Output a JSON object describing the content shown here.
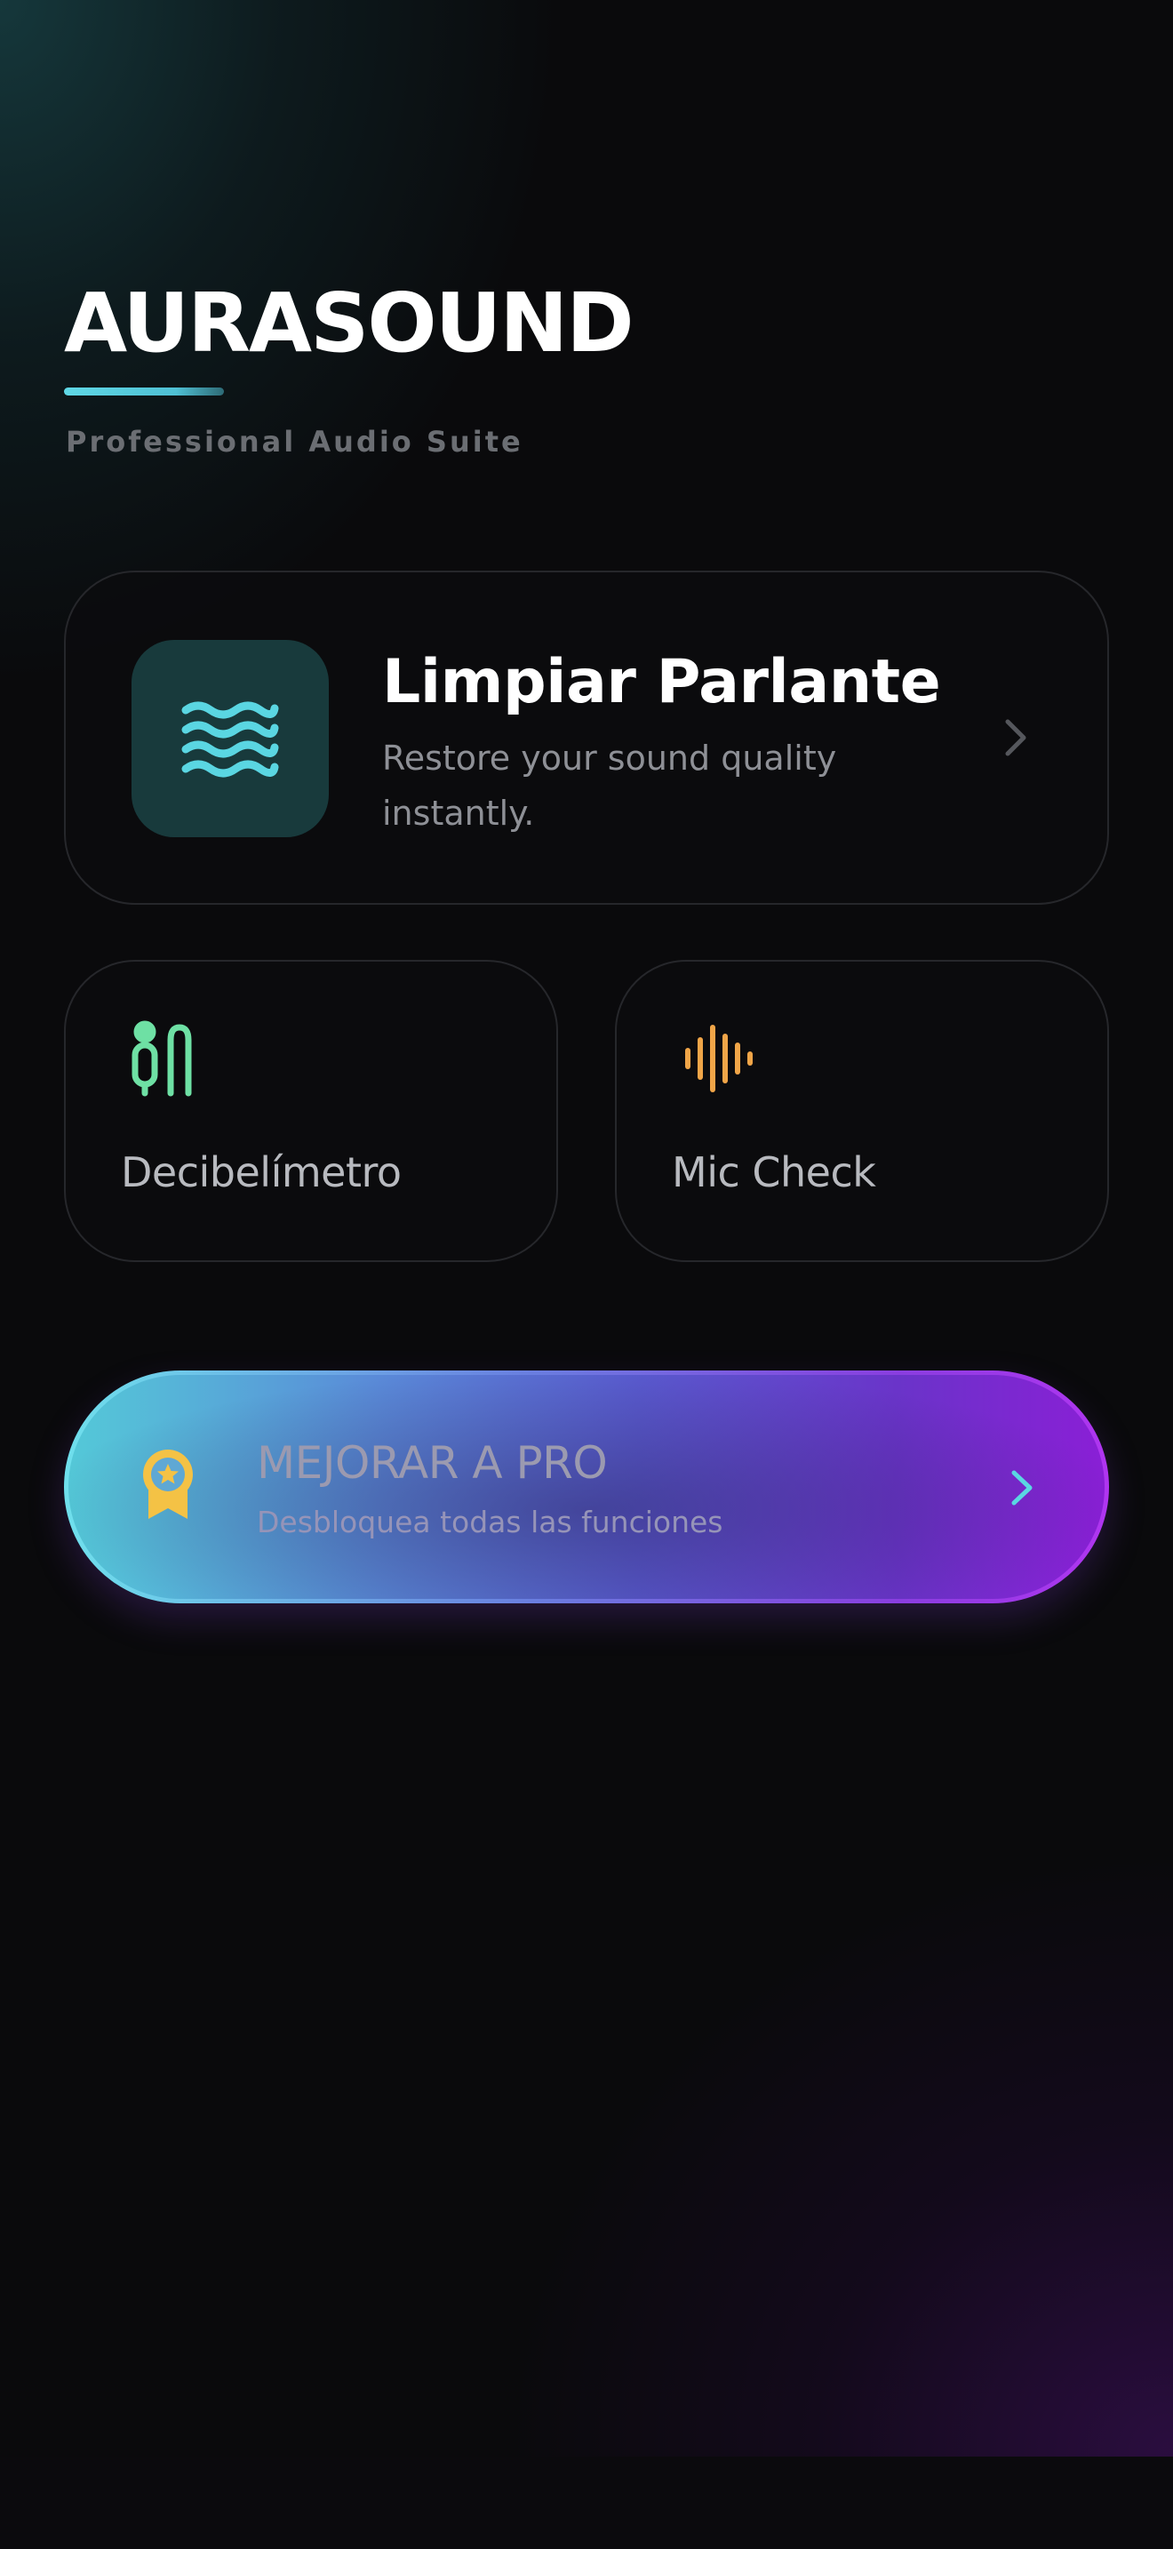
{
  "header": {
    "app_title": "AURASOUND",
    "subtitle": "Professional Audio Suite"
  },
  "main_card": {
    "title": "Limpiar Parlante",
    "description": "Restore your sound quality instantly.",
    "icon": "waves-icon",
    "accent_color": "#5ad6e2"
  },
  "tools": [
    {
      "label": "Decibelímetro",
      "icon": "microphone-cable-icon",
      "color": "#6ee0a4"
    },
    {
      "label": "Mic Check",
      "icon": "waveform-icon",
      "color": "#f0a548"
    }
  ],
  "pro_banner": {
    "title": "MEJORAR A PRO",
    "subtitle": "Desbloquea todas las funciones",
    "icon": "award-badge-icon",
    "icon_color": "#f4c245",
    "chevron_color": "#5ad6e2"
  }
}
